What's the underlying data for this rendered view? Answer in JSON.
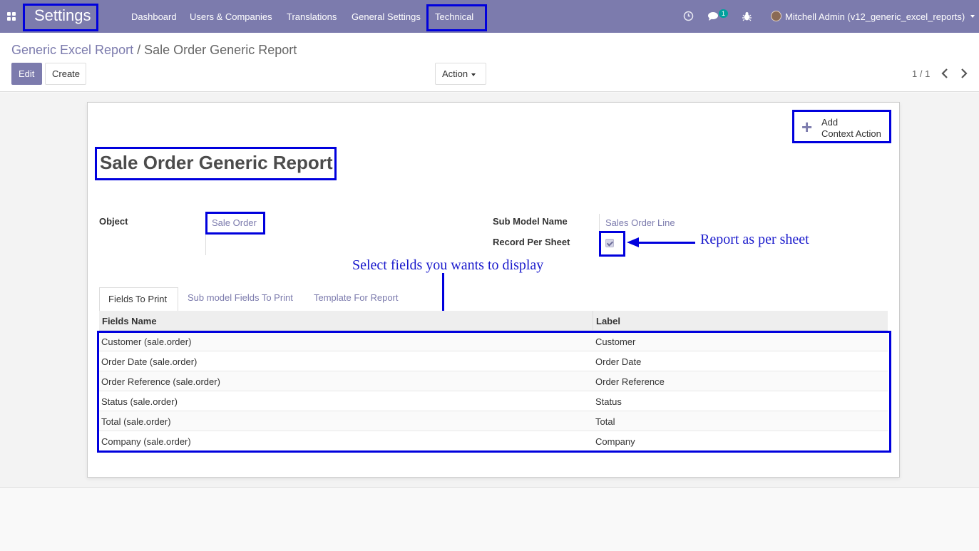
{
  "navbar": {
    "brand": "Settings",
    "menu": [
      "Dashboard",
      "Users & Companies",
      "Translations",
      "General Settings",
      "Technical"
    ],
    "messages_badge": "1",
    "user": "Mitchell Admin (v12_generic_excel_reports)"
  },
  "breadcrumb": {
    "parent": "Generic Excel Report",
    "separator": "/",
    "current": "Sale Order Generic Report"
  },
  "toolbar": {
    "edit_label": "Edit",
    "create_label": "Create",
    "action_label": "Action",
    "pager": "1 / 1"
  },
  "form": {
    "context_action_line1": "Add",
    "context_action_line2": "Context Action",
    "title": "Sale Order Generic Report",
    "object_label": "Object",
    "object_value": "Sale Order",
    "sub_model_label": "Sub Model Name",
    "sub_model_value": "Sales Order Line",
    "record_per_sheet_label": "Record Per Sheet",
    "record_per_sheet_checked": true
  },
  "annotations": {
    "sheet_note": "Report as per sheet",
    "fields_note": "Select fields you wants to display"
  },
  "tabs": [
    "Fields To Print",
    "Sub model Fields To Print",
    "Template For Report"
  ],
  "table": {
    "headers": [
      "Fields Name",
      "Label"
    ],
    "rows": [
      [
        "Customer (sale.order)",
        "Customer"
      ],
      [
        "Order Date (sale.order)",
        "Order Date"
      ],
      [
        "Order Reference (sale.order)",
        "Order Reference"
      ],
      [
        "Status (sale.order)",
        "Status"
      ],
      [
        "Total (sale.order)",
        "Total"
      ],
      [
        "Company (sale.order)",
        "Company"
      ]
    ]
  },
  "colors": {
    "brand": "#7c7bad",
    "annotation": "#0000dd"
  }
}
